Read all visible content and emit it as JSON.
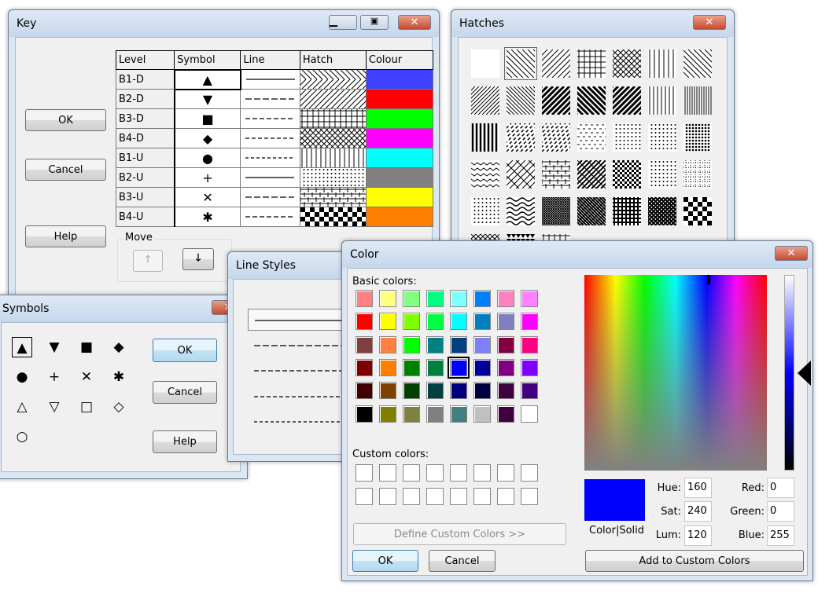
{
  "key": {
    "title": "Key",
    "ok": "OK",
    "cancel": "Cancel",
    "help": "Help",
    "move": "Move",
    "up_icon": "arrow-up-icon",
    "down_icon": "arrow-down-icon",
    "columns": [
      "Level",
      "Symbol",
      "Line",
      "Hatch",
      "Colour"
    ],
    "rows": [
      {
        "level": "B1-D",
        "symbol": "▲",
        "line": "solid",
        "hatch": "chevron",
        "colour": "#4040ff"
      },
      {
        "level": "B2-D",
        "symbol": "▼",
        "line": "dash-long",
        "hatch": "fwd",
        "colour": "#ff0000"
      },
      {
        "level": "B3-D",
        "symbol": "■",
        "line": "dash",
        "hatch": "grid",
        "colour": "#00ff00"
      },
      {
        "level": "B4-D",
        "symbol": "◆",
        "line": "dash-short",
        "hatch": "cross",
        "colour": "#ff00ff"
      },
      {
        "level": "B1-U",
        "symbol": "●",
        "line": "dot",
        "hatch": "vert",
        "colour": "#00ffff"
      },
      {
        "level": "B2-U",
        "symbol": "+",
        "line": "solid",
        "hatch": "dots",
        "colour": "#808080"
      },
      {
        "level": "B3-U",
        "symbol": "✕",
        "line": "dash-long",
        "hatch": "brick",
        "colour": "#ffff00"
      },
      {
        "level": "B4-U",
        "symbol": "✱",
        "line": "dash",
        "hatch": "checker",
        "colour": "#ff8000"
      }
    ]
  },
  "hatches": {
    "title": "Hatches",
    "selected": 1,
    "items": [
      "blank",
      "back",
      "fwd",
      "grid",
      "cross",
      "vert",
      "back",
      "fwd2",
      "back2",
      "fwdT",
      "backT",
      "fwdT",
      "vert2",
      "vert3",
      "vertT",
      "dashfwd",
      "dashfwd",
      "dash",
      "dots",
      "dots",
      "dots2",
      "zigzag",
      "brickdiag",
      "brick",
      "weave",
      "checker2",
      "dots",
      "dotgrid",
      "dots",
      "wave",
      "cross2",
      "back3",
      "gridT",
      "cross3",
      "checker",
      "diamond",
      "tri",
      "grid"
    ]
  },
  "symbols": {
    "title": "Symbols",
    "ok": "OK",
    "cancel": "Cancel",
    "help": "Help",
    "items": [
      "▲",
      "▼",
      "■",
      "◆",
      "●",
      "+",
      "✕",
      "✱",
      "△",
      "▽",
      "□",
      "◇",
      "○"
    ],
    "selected": 0
  },
  "line_styles": {
    "title": "Line Styles",
    "items": [
      "solid",
      "dash-long",
      "dash",
      "dash-short",
      "dot"
    ],
    "selected": 0
  },
  "color": {
    "title": "Color",
    "basic_label": "Basic colors:",
    "custom_label": "Custom colors:",
    "define": "Define Custom Colors >>",
    "ok": "OK",
    "cancel": "Cancel",
    "add": "Add to Custom Colors",
    "color_solid": "Color|Solid",
    "selected": "#0000ff",
    "selected_index": 28,
    "basic": [
      "#ff8080",
      "#ffff80",
      "#80ff80",
      "#00ff80",
      "#80ffff",
      "#0080ff",
      "#ff80c0",
      "#ff80ff",
      "#ff0000",
      "#ffff00",
      "#80ff00",
      "#00ff40",
      "#00ffff",
      "#0080c0",
      "#8080c0",
      "#ff00ff",
      "#804040",
      "#ff8040",
      "#00ff00",
      "#008080",
      "#004080",
      "#8080ff",
      "#800040",
      "#ff0080",
      "#800000",
      "#ff8000",
      "#008000",
      "#008040",
      "#0000ff",
      "#0000a0",
      "#800080",
      "#8000ff",
      "#400000",
      "#804000",
      "#004000",
      "#004040",
      "#000080",
      "#000040",
      "#400040",
      "#400080",
      "#000000",
      "#808000",
      "#808040",
      "#808080",
      "#408080",
      "#c0c0c0",
      "#400040",
      "#ffffff"
    ],
    "fields": {
      "hue_label": "Hue:",
      "hue": "160",
      "sat_label": "Sat:",
      "sat": "240",
      "lum_label": "Lum:",
      "lum": "120",
      "red_label": "Red:",
      "red": "0",
      "green_label": "Green:",
      "green": "0",
      "blue_label": "Blue:",
      "blue": "255"
    }
  }
}
